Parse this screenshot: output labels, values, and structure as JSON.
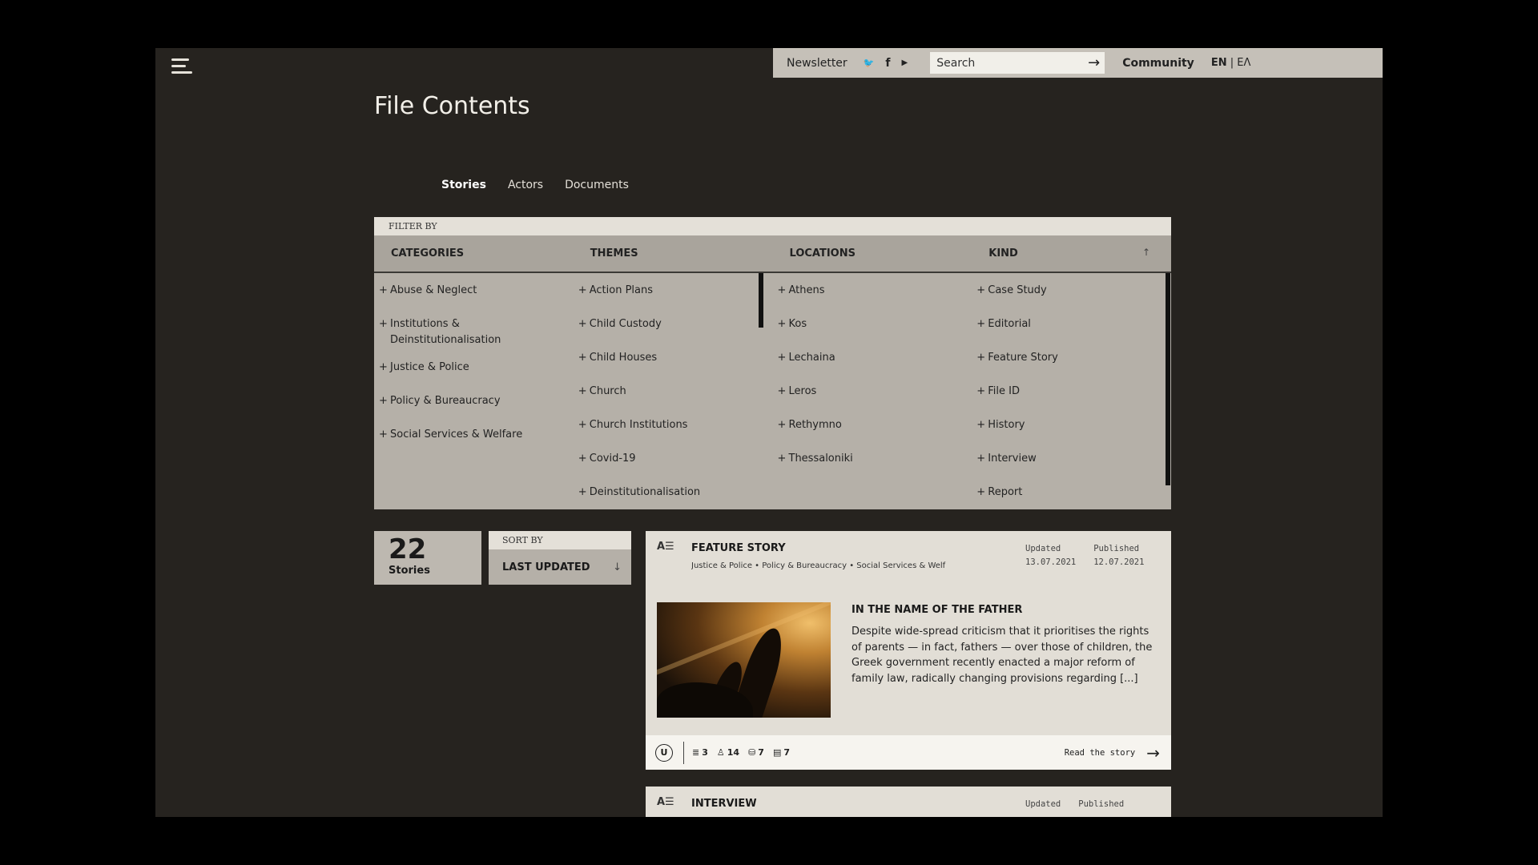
{
  "header": {
    "newsletter": "Newsletter",
    "social": {
      "twitter": "🐦",
      "facebook": "f",
      "youtube": "▶"
    },
    "search_placeholder": "Search",
    "search_arrow": "→",
    "community": "Community",
    "lang_active": "EN",
    "lang_sep": " | ",
    "lang_other": "ΕΛ"
  },
  "page_title": "File Contents",
  "tabs": [
    {
      "label": "Stories",
      "active": true
    },
    {
      "label": "Actors",
      "active": false
    },
    {
      "label": "Documents",
      "active": false
    }
  ],
  "filter": {
    "label": "FILTER BY",
    "sort_toggle": "↑",
    "plus": "+",
    "columns": [
      {
        "title": "CATEGORIES",
        "items": [
          "Abuse & Neglect",
          "Institutions & Deinstitutionalisation",
          "Justice & Police",
          "Policy & Bureaucracy",
          "Social Services & Welfare"
        ]
      },
      {
        "title": "THEMES",
        "items": [
          "Action Plans",
          "Child Custody",
          "Child Houses",
          "Church",
          "Church Institutions",
          "Covid-19",
          "Deinstitutionalisation"
        ]
      },
      {
        "title": "LOCATIONS",
        "items": [
          "Athens",
          "Kos",
          "Lechaina",
          "Leros",
          "Rethymno",
          "Thessaloniki"
        ]
      },
      {
        "title": "KIND",
        "items": [
          "Case Study",
          "Editorial",
          "Feature Story",
          "File ID",
          "History",
          "Interview",
          "Report"
        ]
      }
    ]
  },
  "results": {
    "count": "22",
    "label": "Stories"
  },
  "sort": {
    "label": "SORT BY",
    "value": "LAST UPDATED",
    "arrow": "↓"
  },
  "stories": [
    {
      "kind": "FEATURE STORY",
      "tags": "Justice & Police  •  Policy & Bureaucracy  •  Social Services & Welf",
      "updated_label": "Updated",
      "updated": "13.07.2021",
      "published_label": "Published",
      "published": "12.07.2021",
      "title": "IN THE NAME OF THE FATHER",
      "excerpt": "Despite wide-spread criticism that it prioritises the rights of parents — in fact, fathers — over those of children, the Greek government recently enacted a major reform of family law, radically changing provisions regarding [...]",
      "badge": "U",
      "stats": {
        "stories": "3",
        "actors": "14",
        "records": "7",
        "documents": "7"
      },
      "stat_icons": {
        "stories": "≣",
        "actors": "♙",
        "records": "⛁",
        "documents": "▤"
      },
      "read_more": "Read the story",
      "read_arrow": "→"
    },
    {
      "kind": "INTERVIEW",
      "updated_label": "Updated",
      "published_label": "Published"
    }
  ],
  "icons": {
    "kind_icon": "A☰"
  },
  "colors": {
    "background": "#26231f",
    "panel": "#b5b0a8",
    "topbar": "#c5c0b8",
    "card": "#e2ded6"
  }
}
